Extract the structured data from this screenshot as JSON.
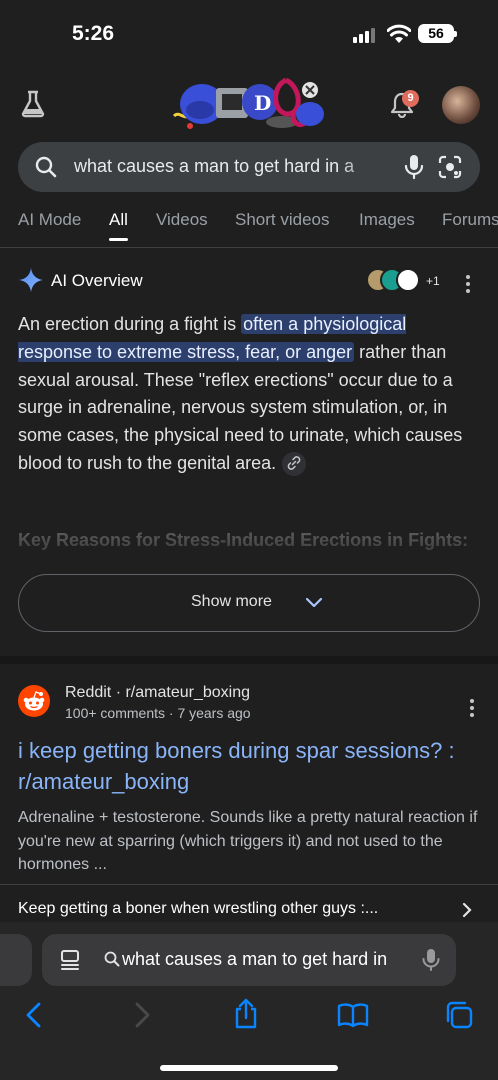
{
  "status": {
    "time": "5:26",
    "battery": "56"
  },
  "header": {
    "notification_count": "9"
  },
  "search": {
    "query": "what causes a man to get hard in a"
  },
  "tabs": [
    "AI Mode",
    "All",
    "Videos",
    "Short videos",
    "Images",
    "Forums"
  ],
  "ai_overview": {
    "title": "AI Overview",
    "sources_more": "+1",
    "text_before": "An erection during a fight is ",
    "text_highlight": "often a physiological response to extreme stress, fear, or anger",
    "text_after": " rather than sexual arousal. These \"reflex erections\" occur due to a surge in adrenaline, nervous system stimulation, or, in some cases, the physical need to urinate, which causes blood to rush to the genital area.",
    "faded_heading": "Key Reasons for Stress-Induced Erections in Fights:",
    "show_more": "Show more"
  },
  "result": {
    "site": "Reddit · r/amateur_boxing",
    "meta": "100+ comments · 7 years ago",
    "title": "i keep getting boners during spar sessions? : r/amateur_boxing",
    "snippet": "Adrenaline + testosterone. Sounds like a pretty natural reaction if you're new at sparring (which triggers it) and not used to the hormones ...",
    "related": "Keep getting a boner when wrestling other guys :..."
  },
  "browser": {
    "url": "what causes a man to get hard in"
  },
  "colors": {
    "background": "#1f1f1f",
    "link": "#8ab4f8",
    "highlight": "#2d3f6d",
    "safari_blue": "#0a84ff"
  }
}
